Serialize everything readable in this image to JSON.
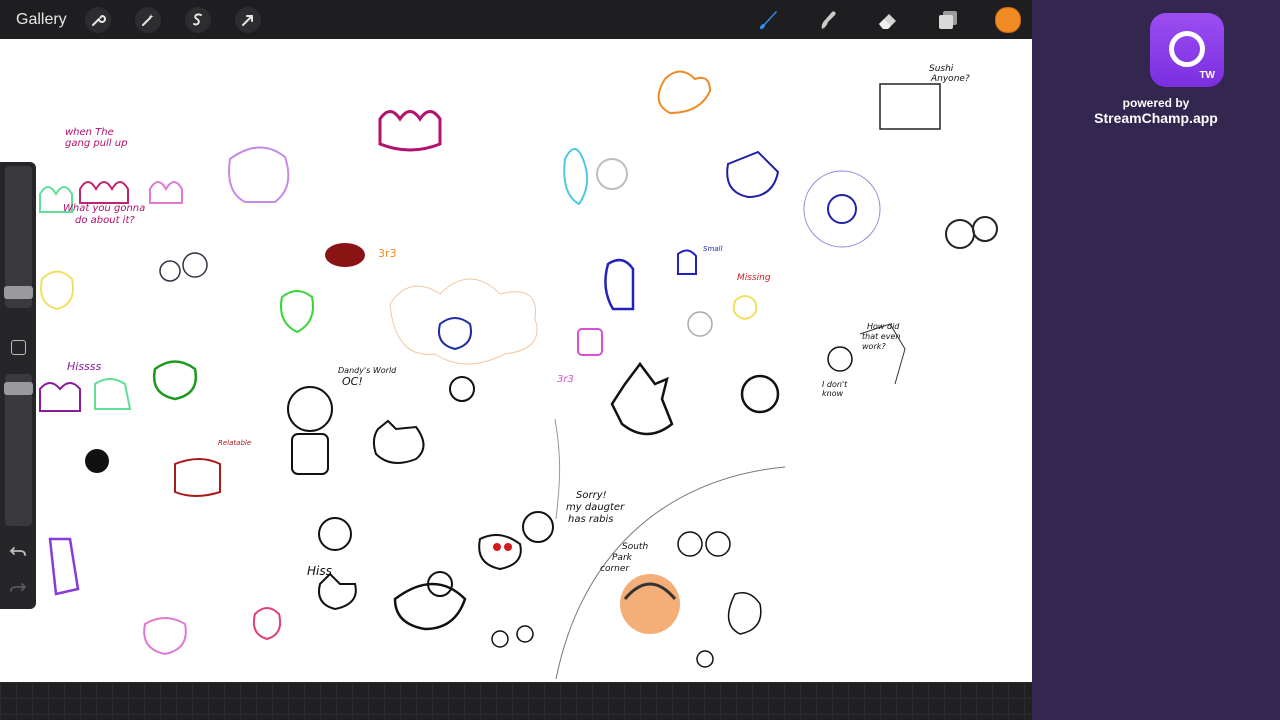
{
  "toolbar": {
    "gallery_label": "Gallery",
    "left_tools": [
      "wrench-icon",
      "magic-wand-icon",
      "selection-icon",
      "transform-arrow-icon"
    ],
    "right_tools": [
      "brush-icon",
      "smudge-icon",
      "eraser-icon",
      "layers-icon"
    ],
    "current_color": "#f08a24"
  },
  "sidebar": {
    "brush_size_percent": 14,
    "opacity_percent": 94
  },
  "overlay": {
    "badge": "TW",
    "powered_by": "powered by",
    "url": "StreamChamp.app"
  },
  "canvas_notes": {
    "gang_top": "when The",
    "gang_top2": "gang pull up",
    "gang_bottom": "What you gonna",
    "gang_bottom2": "do about it?",
    "hiss1": "Hissss",
    "relatable": "Relatable",
    "dandy": "Dandy's World",
    "dandy2": "OC!",
    "small": "Small",
    "missing": "Missing",
    "sushi": "Sushi",
    "sushi2": "Anyone?",
    "how_did": "How did",
    "how_did2": "that even",
    "how_did3": "work?",
    "i_dont": "I don't",
    "i_dont2": "know",
    "sorry": "Sorry!",
    "sorry2": "my daugter",
    "sorry3": "has rabis",
    "south": "South",
    "south2": "Park",
    "south3": "corner",
    "hiss2": "Hiss",
    "three_r_three": "3r3"
  }
}
